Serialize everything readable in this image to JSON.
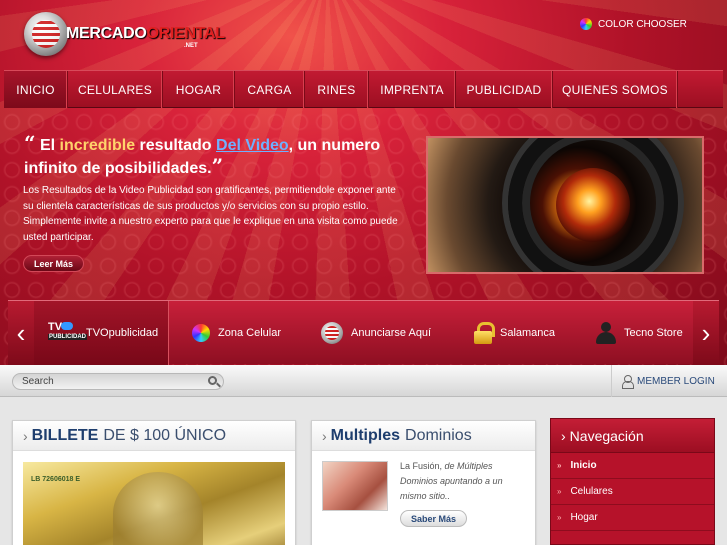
{
  "header": {
    "logo_main": "MERCADO",
    "logo_accent": "ORIENTAL",
    "logo_tld": ".NET",
    "color_chooser": "COLOR CHOOSER"
  },
  "nav": {
    "items": [
      "INICIO",
      "CELULARES",
      "HOGAR",
      "CARGA",
      "RINES",
      "IMPRENTA",
      "PUBLICIDAD",
      "QUIENES SOMOS"
    ],
    "active": "INICIO"
  },
  "hero": {
    "quote_open": "“",
    "quote_close": "”",
    "title_part1": "El ",
    "title_highlight": "incredible",
    "title_part2": " resultado ",
    "title_link": "Del Video",
    "title_part3": ", un numero infinito de posibilidades.",
    "body": "Los Resultados de la Video Publicidad son gratificantes, permitiendole exponer ante su clientela características de sus productos y/o servicios con su propio estilo. Simplemente invite a nuestro experto para que le explique en una visita como puede usted participar.",
    "button": "Leer Más"
  },
  "carousel": {
    "prev_arrow": "‹",
    "next_arrow": "›",
    "tv_logo_top": "TV",
    "tv_logo_bottom": "PUBLICIDAD",
    "items": [
      {
        "label": "TVOpublicidad",
        "icon": "tv-logo-icon"
      },
      {
        "label": "Zona Celular",
        "icon": "color-wheel-icon"
      },
      {
        "label": "Anunciarse Aquí",
        "icon": "globe-icon"
      },
      {
        "label": "Salamanca",
        "icon": "lock-icon"
      },
      {
        "label": "Tecno Store",
        "icon": "user-icon"
      }
    ]
  },
  "toolbar": {
    "search_placeholder": "Search",
    "member_login": "MEMBER LOGIN"
  },
  "panels": {
    "billete": {
      "title_bold": "BILLETE",
      "title_light": "DE $ 100 ÚNICO",
      "serial": "LB 72606018 E"
    },
    "multiples": {
      "arrow": "›",
      "title_bold": "Multiples",
      "title_light": "Dominios",
      "text_plain": "La Fusión, ",
      "text_italic": "de Múltiples Dominios apuntando a un mismo sitio..",
      "button": "Saber Más"
    },
    "navegacion": {
      "arrow": "›",
      "title": "Navegación",
      "bullet": "»",
      "items": [
        "Inicio",
        "Celulares",
        "Hogar"
      ]
    }
  },
  "colors": {
    "brand_red": "#b6122a",
    "link_blue": "#6fb1ff",
    "highlight_gold": "#ffd36b"
  }
}
